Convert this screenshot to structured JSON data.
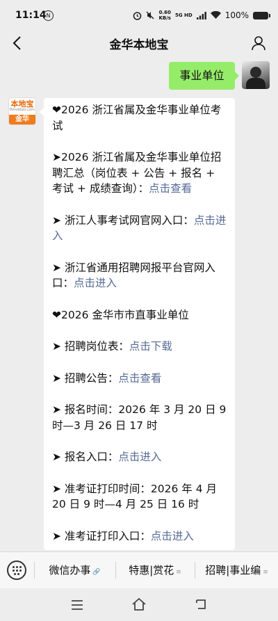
{
  "status": {
    "time": "11:14",
    "nfc": "N",
    "speed_value": "0.60",
    "speed_unit": "KB/s",
    "network": "5G HD",
    "battery": "100%"
  },
  "header": {
    "title": "金华本地宝"
  },
  "sent_message": {
    "text": "事业单位"
  },
  "bot": {
    "logo": "本地宝",
    "domain": "Bendibao.com",
    "city": "金华"
  },
  "message": {
    "p1": "❤2026 浙江省属及金华事业单位考试",
    "p2_text": "➤2026 浙江省属及金华事业单位招聘汇总（岗位表 + 公告 + 报名 + 考试 + 成绩查询）：",
    "p2_link": "点击查看",
    "p3_text": "➤ 浙江人事考试网官网入口：",
    "p3_link": "点击进入",
    "p4_text": "➤ 浙江省通用招聘网报平台官网入口：",
    "p4_link": "点击进入",
    "p5": "❤2026 金华市市直事业单位",
    "p6_text": "➤ 招聘岗位表：",
    "p6_link": "点击下载",
    "p7_text": "➤ 招聘公告：",
    "p7_link": "点击查看",
    "p8": "➤ 报名时间：2026 年 3 月 20 日 9 时—3 月 26 日 17 时",
    "p9_text": "➤ 报名入口：",
    "p9_link": "点击进入",
    "p10": "➤ 准考证打印时间：2026 年 4 月 20 日 9 时—4 月 25 日 16 时",
    "p11_text": "➤ 准考证打印入口：",
    "p11_link": "点击进入"
  },
  "menu": {
    "item1": "微信办事",
    "item2": "特惠|赏花",
    "item3": "招聘|事业编",
    "item1_marker": "🔗",
    "item2_marker": "≡",
    "item3_marker": "≡"
  }
}
